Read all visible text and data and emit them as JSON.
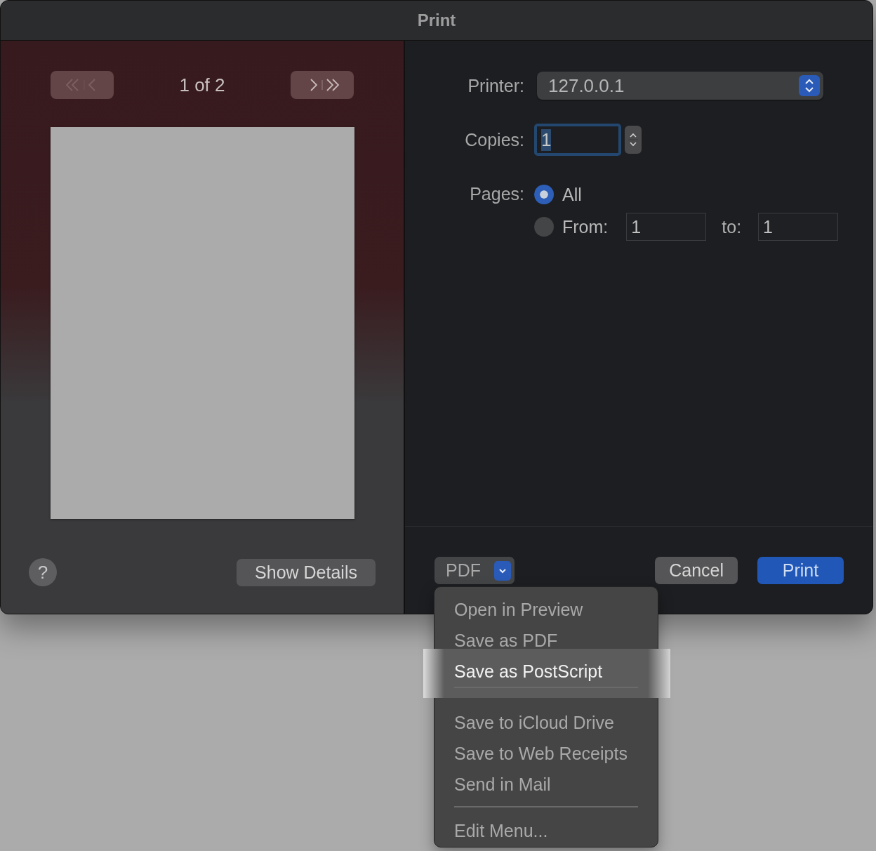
{
  "window": {
    "title": "Print"
  },
  "preview": {
    "navigation": [
      {
        "kind": "back",
        "disabled": true
      },
      {
        "kind": "forward",
        "disabled": false
      }
    ],
    "page_indicator": "1 of 2"
  },
  "help_button": {
    "label": "?"
  },
  "show_details_button": {
    "label": "Show Details"
  },
  "printer": {
    "label": "Printer:",
    "value": "127.0.0.1"
  },
  "copies": {
    "label": "Copies:",
    "value": "1"
  },
  "pages": {
    "label": "Pages:",
    "options": [
      {
        "label": "All",
        "selected": true
      },
      {
        "label": "From:",
        "selected": false
      }
    ],
    "from": "1",
    "to_label": "to:",
    "to": "1"
  },
  "pdf_button": {
    "label": "PDF"
  },
  "buttons": [
    {
      "label": "Cancel",
      "kind": "secondary"
    },
    {
      "label": "Print",
      "kind": "default"
    }
  ],
  "pdf_menu": {
    "items": [
      {
        "kind": "item",
        "label": "Open in Preview",
        "selected": false
      },
      {
        "kind": "item",
        "label": "Save as PDF",
        "selected": false
      },
      {
        "kind": "item",
        "label": "Save as PostScript",
        "selected": true
      },
      {
        "kind": "separator"
      },
      {
        "kind": "item",
        "label": "Save to iCloud Drive",
        "selected": false
      },
      {
        "kind": "item",
        "label": "Save to Web Receipts",
        "selected": false
      },
      {
        "kind": "item",
        "label": "Send in Mail",
        "selected": false
      },
      {
        "kind": "separator"
      },
      {
        "kind": "item",
        "label": "Edit Menu...",
        "selected": false
      }
    ]
  }
}
